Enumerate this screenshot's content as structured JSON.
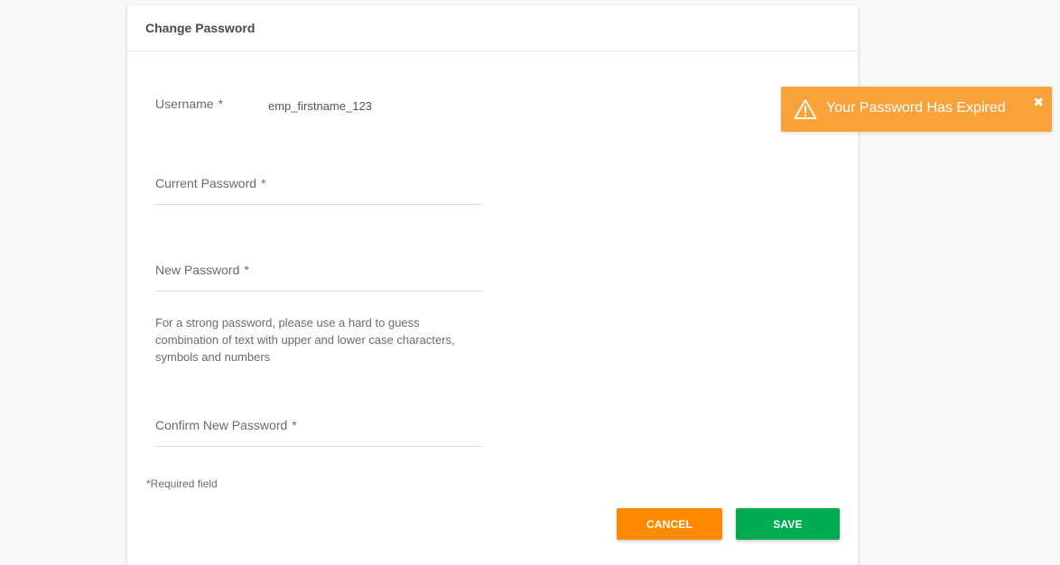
{
  "card": {
    "title": "Change Password"
  },
  "form": {
    "username": {
      "label": "Username",
      "required_mark": "*",
      "value": "emp_firstname_123"
    },
    "current_password": {
      "label": "Current Password",
      "required_mark": "*",
      "value": ""
    },
    "new_password": {
      "label": "New Password",
      "required_mark": "*",
      "value": ""
    },
    "hint": "For a strong password, please use a hard to guess combination of text with upper and lower case characters, symbols and numbers",
    "confirm_password": {
      "label": "Confirm New Password",
      "required_mark": "*",
      "value": ""
    },
    "required_note": "*Required field"
  },
  "buttons": {
    "cancel_label": "CANCEL",
    "save_label": "SAVE"
  },
  "toast": {
    "message": "Your Password Has Expired",
    "close_glyph": "✖",
    "icon": "warning-icon"
  },
  "colors": {
    "cancel": "#ff8a00",
    "save": "#00ac51",
    "toast": "#f9a23a"
  }
}
